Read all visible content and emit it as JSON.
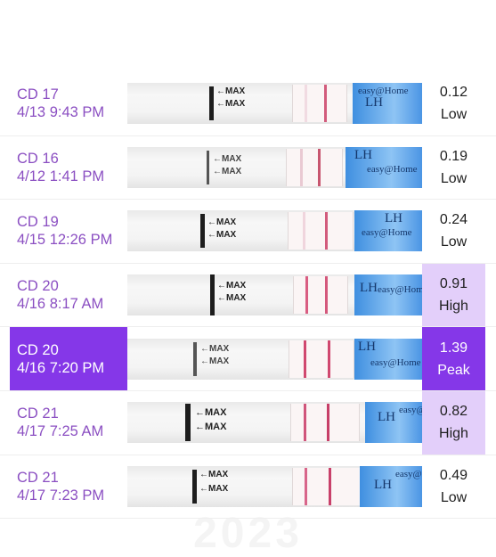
{
  "year_header": "2023",
  "colors": {
    "accent": "#8537e8",
    "date_text": "#8b4fc2",
    "high_bg": "#e3cffa",
    "lh_tag": "#6fb3ef"
  },
  "strip_text": {
    "max": "MAX",
    "arrow": "←",
    "lh": "LH",
    "brand": "easy@Home"
  },
  "rows": [
    {
      "cycle_day": "CD 17",
      "datetime": "4/13 9:43 PM",
      "value": "0.12",
      "level": "Low",
      "selected": false
    },
    {
      "cycle_day": "CD 16",
      "datetime": "4/12 1:41 PM",
      "value": "0.19",
      "level": "Low",
      "selected": false
    },
    {
      "cycle_day": "CD 19",
      "datetime": "4/15 12:26 PM",
      "value": "0.24",
      "level": "Low",
      "selected": false
    },
    {
      "cycle_day": "CD 20",
      "datetime": "4/16 8:17 AM",
      "value": "0.91",
      "level": "High",
      "selected": false
    },
    {
      "cycle_day": "CD 20",
      "datetime": "4/16 7:20 PM",
      "value": "1.39",
      "level": "Peak",
      "selected": true
    },
    {
      "cycle_day": "CD 21",
      "datetime": "4/17 7:25 AM",
      "value": "0.82",
      "level": "High",
      "selected": false
    },
    {
      "cycle_day": "CD 21",
      "datetime": "4/17 7:23 PM",
      "value": "0.49",
      "level": "Low",
      "selected": false
    }
  ]
}
